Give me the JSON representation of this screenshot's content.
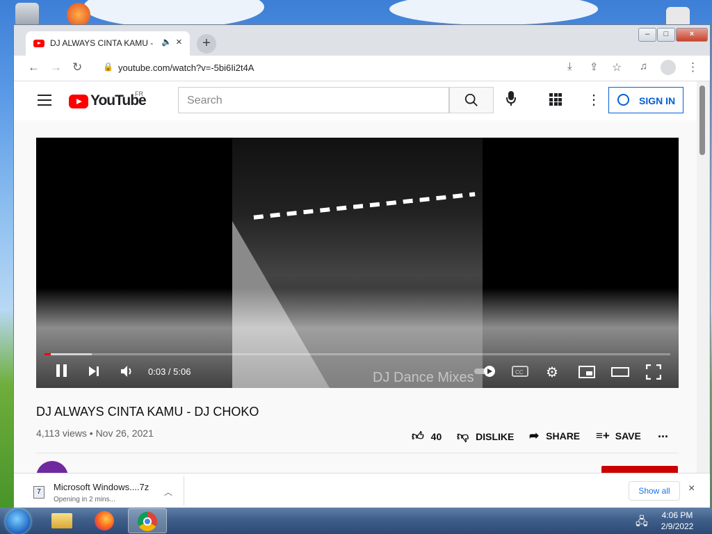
{
  "browser": {
    "tab_title": "DJ ALWAYS CINTA KAMU - D",
    "tab_close": "×",
    "new_tab": "+",
    "url": "youtube.com/watch?v=-5bi6Ii2t4A",
    "window_minimize": "–",
    "window_maximize": "□",
    "window_close": "×"
  },
  "youtube": {
    "logo_text": "YouTube",
    "logo_region": "FR",
    "search_placeholder": "Search",
    "sign_in_label": "SIGN IN"
  },
  "player": {
    "watermark": "DJ Dance Mixes",
    "time": "0:03 / 5:06",
    "progress_fraction": 0.0098
  },
  "video": {
    "title": "DJ ALWAYS CINTA KAMU - DJ CHOKO",
    "meta": "4,113 views • Nov 26, 2021",
    "like_count": "40",
    "dislike_label": "DISLIKE",
    "share_label": "SHARE",
    "save_label": "SAVE",
    "more": "..."
  },
  "download_bar": {
    "file_name": "Microsoft Windows....7z",
    "status": "Opening in 2 mins...",
    "show_all_label": "Show all",
    "close": "×"
  },
  "taskbar": {
    "time": "4:06 PM",
    "date": "2/9/2022"
  },
  "colors": {
    "youtube_red": "#ff0000",
    "sign_in_blue": "#065fd4",
    "taskbar": "#3f5f8a"
  }
}
